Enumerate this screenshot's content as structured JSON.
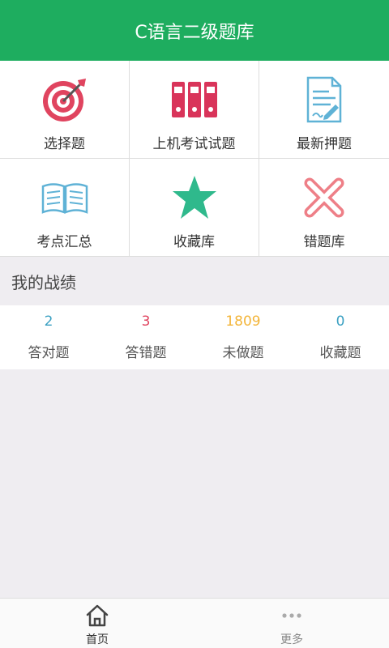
{
  "header": {
    "title": "C语言二级题库"
  },
  "grid": [
    {
      "label": "选择题",
      "icon": "target-icon"
    },
    {
      "label": "上机考试试题",
      "icon": "binders-icon"
    },
    {
      "label": "最新押题",
      "icon": "document-pen-icon"
    },
    {
      "label": "考点汇总",
      "icon": "open-book-icon"
    },
    {
      "label": "收藏库",
      "icon": "star-icon"
    },
    {
      "label": "错题库",
      "icon": "cross-icon"
    }
  ],
  "section": {
    "title": "我的战绩"
  },
  "stats": [
    {
      "value": "2",
      "label": "答对题",
      "color": "#3aa0c2"
    },
    {
      "value": "3",
      "label": "答错题",
      "color": "#e0445f"
    },
    {
      "value": "1809",
      "label": "未做题",
      "color": "#f3b53a"
    },
    {
      "value": "0",
      "label": "收藏题",
      "color": "#3aa0c2"
    }
  ],
  "tabbar": {
    "home": {
      "label": "首页",
      "icon": "home-icon"
    },
    "more": {
      "label": "更多",
      "icon": "more-dots-icon"
    }
  },
  "colors": {
    "primary": "#1ead5f",
    "target": "#e0445f",
    "star": "#2fb98c",
    "cross": "#ee7f87",
    "book": "#5fb2d6"
  }
}
